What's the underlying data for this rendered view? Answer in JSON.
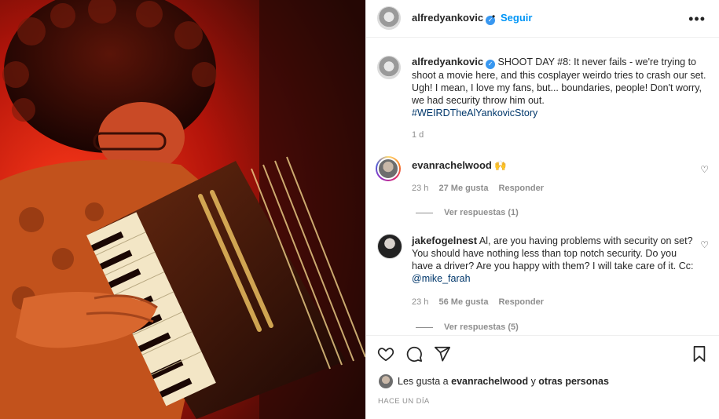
{
  "post": {
    "author": "alfredyankovic",
    "follow_label": "Seguir",
    "dot": "•",
    "more_icon": "more-horizontal-icon",
    "verified_icon": "verified-badge-icon",
    "caption": {
      "username": "alfredyankovic",
      "text": "SHOOT DAY #8: It never fails - we're trying to shoot a movie here, and this cosplayer weirdo tries to crash our set. Ugh! I mean, I love my fans, but... boundaries, people! Don't worry, we had security throw him out.",
      "hashtag": "#WEIRDTheAlYankovicStory",
      "time": "1 d"
    }
  },
  "comments": [
    {
      "username": "evanrachelwood",
      "text": "🙌",
      "time": "23 h",
      "likes": "27 Me gusta",
      "reply": "Responder",
      "view_replies": "Ver respuestas (1)"
    },
    {
      "username": "jakefogelnest",
      "text": "Al, are you having problems with security on set? You should have nothing less than top notch security. Do you have a driver? Are you happy with them? I will take care of it. Cc: ",
      "mention": "@mike_farah",
      "time": "23 h",
      "likes": "56 Me gusta",
      "reply": "Responder",
      "view_replies": "Ver respuestas (5)"
    }
  ],
  "actions": {
    "icons": [
      "heart-icon",
      "comment-icon",
      "share-icon",
      "bookmark-icon"
    ],
    "likes_prefix": "Les gusta a",
    "likes_user": "evanrachelwood",
    "likes_conj": "y",
    "likes_others": "otras personas",
    "time_ago": "HACE UN DÍA"
  },
  "colors": {
    "accent": "#0095f6",
    "hashtag": "#00376b",
    "muted": "#8e8e8e"
  }
}
